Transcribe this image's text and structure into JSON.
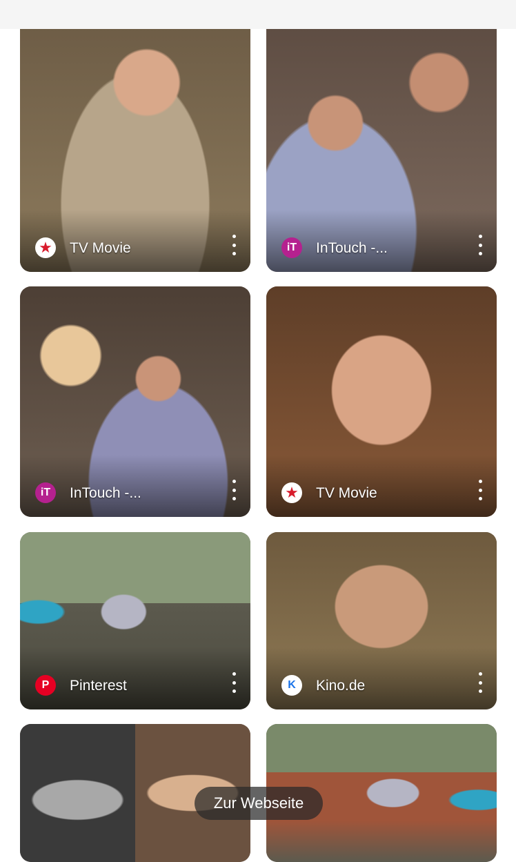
{
  "cta": {
    "label": "Zur Webseite"
  },
  "icons": {
    "tvmovie": "tv-movie-star-icon",
    "intouch": "intouch-logo-icon",
    "pinterest": "pinterest-logo-icon",
    "kino": "kino-de-logo-icon",
    "more": "more-vert-icon"
  },
  "colors": {
    "tvmovie": "#d81b2c",
    "intouch": "#b5218f",
    "pinterest": "#e60023",
    "kino": "#1a73e8"
  },
  "results": [
    {
      "source": "TV Movie",
      "icon_letter": "★"
    },
    {
      "source": "InTouch -...",
      "icon_letter": "iT"
    },
    {
      "source": "InTouch -...",
      "icon_letter": "iT"
    },
    {
      "source": "TV Movie",
      "icon_letter": "★"
    },
    {
      "source": "Pinterest",
      "icon_letter": "P"
    },
    {
      "source": "Kino.de",
      "icon_letter": "K"
    }
  ]
}
